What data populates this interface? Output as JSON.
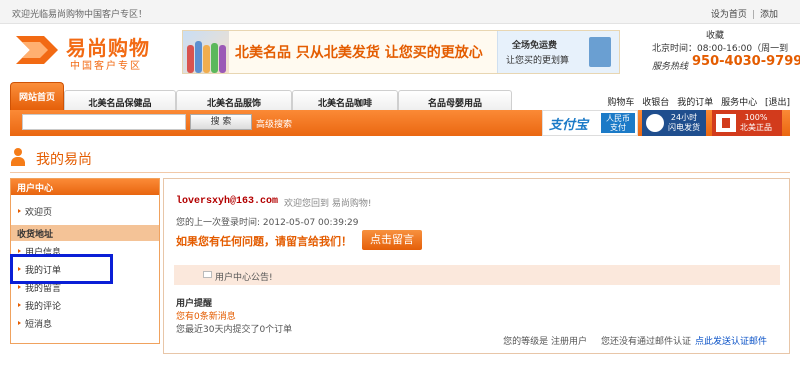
{
  "top_bar": {
    "welcome": "欢迎光临易尚购物中国客户专区！",
    "set_home": "设为首页",
    "separator": "|",
    "bookmark": "添加"
  },
  "logo": {
    "title": "易尚购物",
    "subtitle": "中国客户专区",
    "color": "#f26a13"
  },
  "banner": {
    "slogan": "北美名品 只从北美发货 让您买的更放心",
    "promo_line1": "全场免运费",
    "promo_line2": "让您买的更划算"
  },
  "service": {
    "favorite": "收藏",
    "time": "北京时间：08:00-16:00（周一到",
    "hotline_label": "服务热线",
    "hotline_number": "950-4030-9799"
  },
  "nav": {
    "home": "网站首页",
    "tabs": [
      "北美名品保健品",
      "北美名品服饰",
      "北美名品咖啡",
      "名品母婴用品"
    ],
    "links": [
      "购物车",
      "收银台",
      "我的订单",
      "服务中心",
      "[退出]"
    ]
  },
  "search": {
    "value": "",
    "button": "搜  索",
    "advanced": "高级搜索"
  },
  "badges": {
    "alipay": "支付宝",
    "alipay_tag_l1": "人民币",
    "alipay_tag_l2": "支付",
    "fast_l1": "24小时",
    "fast_l2": "闪电发货",
    "genuine_l1": "100%",
    "genuine_l2": "北美正品"
  },
  "page_title": "我的易尚",
  "sidebar": {
    "header": "用户中心",
    "items_top": [
      "欢迎页"
    ],
    "section": "收货地址",
    "items": [
      "用户信息",
      "我的订单",
      "我的留言",
      "我的评论",
      "短消息"
    ]
  },
  "main": {
    "email": "loversxyh@163.com",
    "welcome": "欢迎您回到 易尚购物!",
    "last_login": "您的上一次登录时间: 2012-05-07 00:39:29",
    "question": "如果您有任何问题，请留言给我们！",
    "leave_message_button": "点击留言",
    "notice": "用户中心公告!",
    "remind_label": "用户提醒",
    "messages": "您有0条新消息",
    "orders": "您最近30天内提交了0个订单",
    "level": "您的等级是 注册用户",
    "email_unverified": "您还没有通过邮件认证",
    "verify_link": "点此发送认证邮件"
  },
  "colors": {
    "accent": "#f26a13",
    "highlight_box": "#0a1fd6",
    "link": "#0a52c7"
  }
}
